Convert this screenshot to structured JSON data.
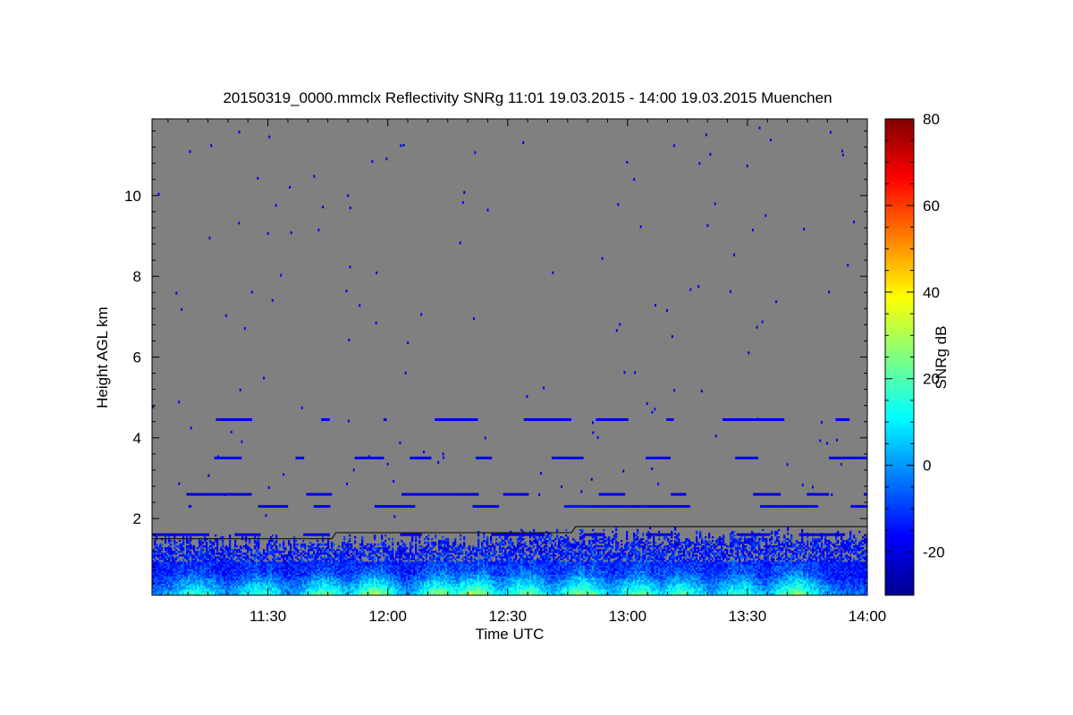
{
  "chart_data": {
    "type": "heatmap",
    "title": "20150319_0000.mmclx Reflectivity SNRg   11:01 19.03.2015 - 14:00 19.03.2015 Muenchen",
    "xlabel": "Time UTC",
    "ylabel": "Height AGL km",
    "x_range": [
      "11:01",
      "14:00"
    ],
    "x_ticks": [
      "11:30",
      "12:00",
      "12:30",
      "13:00",
      "13:30",
      "14:00"
    ],
    "ylim": [
      0.1,
      11.9
    ],
    "y_ticks": [
      "2",
      "4",
      "6",
      "8",
      "10"
    ],
    "colorbar": {
      "label": "SNRg dB",
      "range": [
        -30,
        80
      ],
      "ticks": [
        "-20",
        "0",
        "20",
        "40",
        "60",
        "80"
      ],
      "colormap": [
        "#00008f",
        "#0000ff",
        "#0080ff",
        "#00ffff",
        "#80ff80",
        "#ffff00",
        "#ff8000",
        "#ff0000",
        "#800000"
      ]
    },
    "background_color": "#808080",
    "echo_layers": [
      {
        "height_km": 4.45,
        "snr_db": -20
      },
      {
        "height_km": 3.5,
        "snr_db": -20
      },
      {
        "height_km": 2.3,
        "snr_db": -18
      },
      {
        "height_km": 2.6,
        "snr_db": -22
      },
      {
        "height_km": 1.6,
        "snr_db": -22
      }
    ],
    "boundary_layer_top_km": [
      {
        "time": "11:01",
        "height": 1.5
      },
      {
        "time": "11:46",
        "height": 1.5
      },
      {
        "time": "11:47",
        "height": 1.65
      },
      {
        "time": "12:46",
        "height": 1.65
      },
      {
        "time": "12:47",
        "height": 1.8
      },
      {
        "time": "14:00",
        "height": 1.8
      }
    ]
  }
}
